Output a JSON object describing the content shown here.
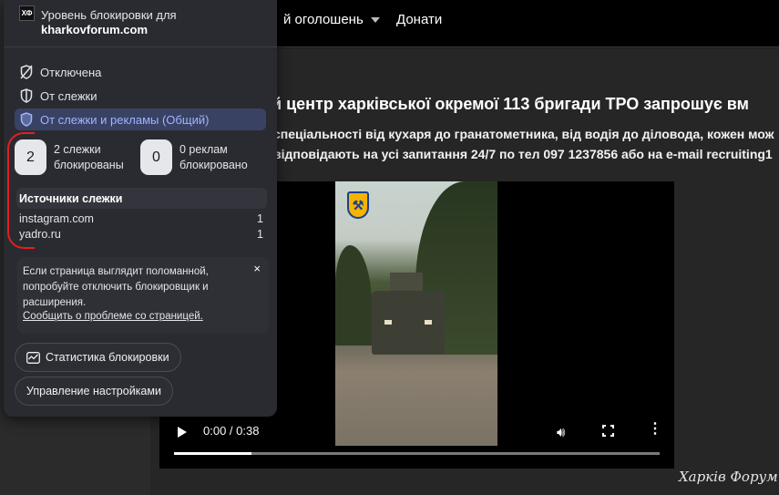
{
  "page": {
    "nav": {
      "item1": "й оголошень",
      "item2": "Донати"
    },
    "headline": "й центр харківської окремої 113 бригади ТРО запрошує вм",
    "body_line1": "спеціальності від кухаря до гранатометника, від водія до діловода, кожен мож",
    "body_line2": "відповідають на усі запитання 24/7 по тел 097 1237856 або на e-mail recruiting1",
    "video": {
      "time": "0:00 / 0:38",
      "progress": 0.16
    },
    "watermark": "Харків Форум"
  },
  "popup": {
    "favicon_text": "ХФ",
    "title": "Уровень блокировки для",
    "site": "kharkovforum.com",
    "levels": [
      {
        "label": "Отключена",
        "icon": "shield-off-icon",
        "active": false
      },
      {
        "label": "От слежки",
        "icon": "shield-icon",
        "active": false
      },
      {
        "label": "От слежки и рекламы (Общий)",
        "icon": "shield-filled-icon",
        "active": true
      }
    ],
    "stats": {
      "trackers_count": "2",
      "trackers_label": "2 слежки блокированы",
      "ads_count": "0",
      "ads_label": "0 реклам блокировано"
    },
    "trackers_title": "Источники слежки",
    "trackers": [
      {
        "domain": "instagram.com",
        "count": "1"
      },
      {
        "domain": "yadro.ru",
        "count": "1"
      }
    ],
    "notice": {
      "text": "Если страница выглядит поломанной, попробуйте отключить блокировщик и расширения.",
      "link": "Сообщить о проблеме со страницей.",
      "close": "×"
    },
    "stats_button": "Статистика блокировки",
    "settings_button": "Управление настройками"
  },
  "colors": {
    "active_accent": "#9fb4ff",
    "annotation": "#e02020"
  }
}
